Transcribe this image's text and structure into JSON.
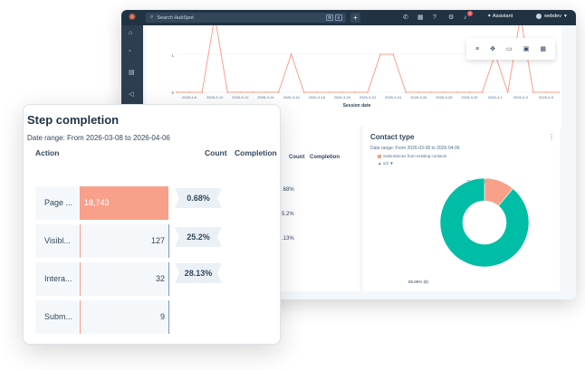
{
  "topbar": {
    "search_placeholder": "Search HubSpot",
    "kbd_keys": [
      "⌘",
      "K"
    ],
    "assistant_label": "Assistant",
    "account_name": "webdev",
    "notification_count": "3"
  },
  "session_chart": {
    "xlabel": "Session date",
    "ytick_labels": [
      "0",
      "1"
    ],
    "dates": [
      "2026-3-8",
      "2026-3-10",
      "2026-3-12",
      "2026-3-14",
      "2026-3-16",
      "2026-3-18",
      "2026-3-20",
      "2026-3-22",
      "2026-3-24",
      "2026-3-26",
      "2026-3-28",
      "2026-3-30",
      "2026-4-1",
      "2026-4-3",
      "2026-4-5"
    ],
    "color": "#f8a08a"
  },
  "chart_data": {
    "type": "line",
    "x": [
      "2026-3-7",
      "2026-3-8",
      "2026-3-9",
      "2026-3-10",
      "2026-3-11",
      "2026-3-12",
      "2026-3-13",
      "2026-3-14",
      "2026-3-15",
      "2026-3-16",
      "2026-3-17",
      "2026-3-18",
      "2026-3-19",
      "2026-3-20",
      "2026-3-21",
      "2026-3-22",
      "2026-3-23",
      "2026-3-24",
      "2026-3-25",
      "2026-3-26",
      "2026-3-27",
      "2026-3-28",
      "2026-3-29",
      "2026-3-30",
      "2026-3-31",
      "2026-4-1",
      "2026-4-2",
      "2026-4-3",
      "2026-4-4",
      "2026-4-5",
      "2026-4-6"
    ],
    "values": [
      0,
      0,
      0,
      2,
      0,
      0,
      0,
      0,
      0,
      1,
      0,
      0,
      0,
      0,
      0,
      0,
      1,
      1,
      0,
      0,
      0,
      0,
      0,
      0,
      0,
      1,
      0,
      2,
      0,
      0,
      0
    ],
    "xlabel": "Session date",
    "ylim": [
      0,
      2
    ],
    "grid": true
  },
  "step_completion": {
    "title": "Step completion",
    "date_range": "Date range: From 2026-03-08 to 2026-04-06",
    "headers": {
      "action": "Action",
      "count": "Count",
      "completion": "Completion"
    },
    "rows": [
      {
        "label": "Page ...",
        "count": "18,743",
        "count_value": 18743
      },
      {
        "label": "Visibl...",
        "count": "127",
        "count_value": 127
      },
      {
        "label": "Intera...",
        "count": "32",
        "count_value": 32
      },
      {
        "label": "Subm...",
        "count": "9",
        "count_value": 9
      }
    ],
    "completion": [
      "0.68%",
      "25.2%",
      "28.13%"
    ],
    "bar_color": "#f8a08a"
  },
  "mid_card": {
    "headers": {
      "count": "Count",
      "completion": "Completion"
    },
    "partial_values": [
      ".68%",
      "5.2%",
      ".13%"
    ]
  },
  "contact_type": {
    "title": "Contact type",
    "date_range": "Date range: From 2026-03-08 to 2026-04-06",
    "legend": "Submissions from existing contacts",
    "page": "1/2",
    "slices": [
      {
        "label": "11.11% (1)",
        "value": 11.11,
        "color": "#f8a08a"
      },
      {
        "label": "88.89% (8)",
        "value": 88.89,
        "color": "#00bda5"
      }
    ]
  }
}
